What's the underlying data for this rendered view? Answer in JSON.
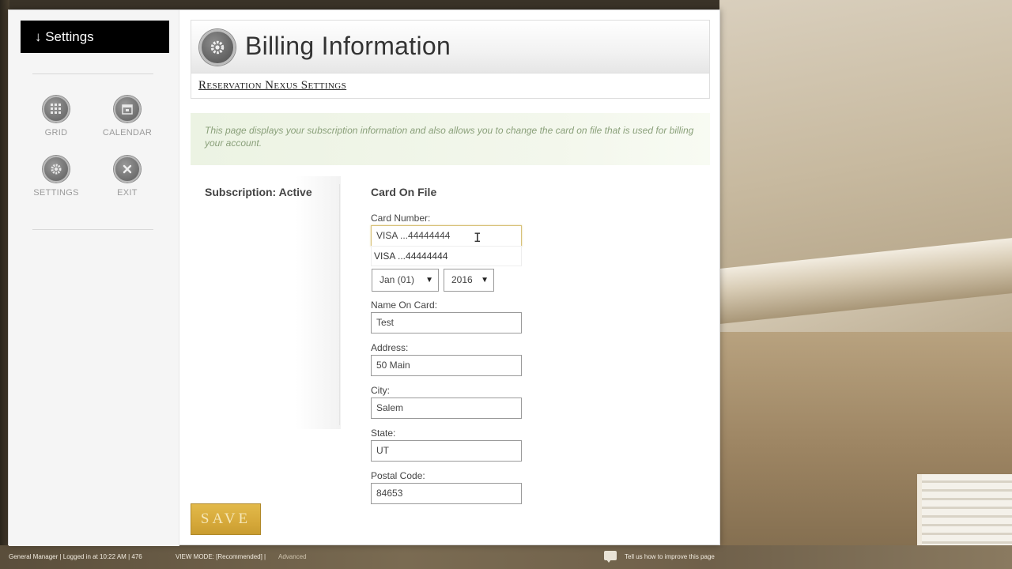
{
  "sidebar": {
    "header_label": "↓ Settings",
    "nav": [
      {
        "label": "GRID",
        "icon": "grid-icon"
      },
      {
        "label": "CALENDAR",
        "icon": "calendar-icon"
      },
      {
        "label": "SETTINGS",
        "icon": "gear-icon"
      },
      {
        "label": "EXIT",
        "icon": "exit-icon"
      }
    ]
  },
  "page": {
    "title": "Billing Information",
    "breadcrumb": "Reservation Nexus Settings",
    "info_text": "This page displays your subscription information and also allows you to change the card on file that is used for billing your account."
  },
  "subscription": {
    "label": "Subscription: Active"
  },
  "card_form": {
    "heading": "Card On File",
    "card_number_label": "Card Number:",
    "card_number_value": "VISA ...44444444",
    "autocomplete_suggestion": "VISA ...44444444",
    "exp_month": "Jan (01)",
    "exp_year": "2016",
    "name_label": "Name On Card:",
    "name_value": "Test",
    "address_label": "Address:",
    "address_value": "50 Main",
    "city_label": "City:",
    "city_value": "Salem",
    "state_label": "State:",
    "state_value": "UT",
    "postal_label": "Postal Code:",
    "postal_value": "84653"
  },
  "actions": {
    "save_label": "SAVE"
  },
  "footer": {
    "user_info": "General Manager | Logged in at 10:22 AM | 476",
    "view_mode": "VIEW MODE: [Recommended] |",
    "advanced": "Advanced",
    "feedback": "Tell us how to improve this page"
  },
  "colors": {
    "accent_gold": "#d6a93a",
    "info_green": "#8aa07a",
    "header_black": "#000000"
  }
}
